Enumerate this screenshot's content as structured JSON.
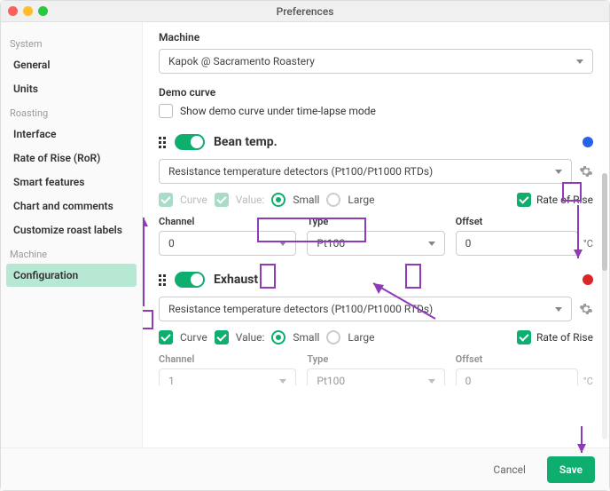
{
  "window": {
    "title": "Preferences"
  },
  "sidebar": {
    "groups": [
      {
        "label": "System",
        "items": [
          "General",
          "Units"
        ]
      },
      {
        "label": "Roasting",
        "items": [
          "Interface",
          "Rate of Rise (RoR)",
          "Smart features",
          "Chart and comments",
          "Customize roast labels"
        ]
      },
      {
        "label": "Machine",
        "items": [
          "Configuration"
        ]
      }
    ],
    "active": "Configuration"
  },
  "main": {
    "machine_label": "Machine",
    "machine_value": "Kapok @ Sacramento Roastery",
    "demo_label": "Demo curve",
    "demo_text": "Show demo curve under time-lapse mode"
  },
  "sensors": [
    {
      "name": "Bean temp.",
      "color": "blue",
      "detector": "Resistance temperature detectors (Pt100/Pt1000 RTDs)",
      "curve_disabled": true,
      "value_disabled": true,
      "curve_label": "Curve",
      "value_label": "Value:",
      "size_small": "Small",
      "size_large": "Large",
      "size_selected": "small",
      "ror_label": "Rate of Rise",
      "channel_label": "Channel",
      "channel_value": "0",
      "type_label": "Type",
      "type_value": "Pt100",
      "offset_label": "Offset",
      "offset_value": "0",
      "offset_unit": "°C"
    },
    {
      "name": "Exhaust",
      "color": "red",
      "detector": "Resistance temperature detectors (Pt100/Pt1000 RTDs)",
      "curve_disabled": false,
      "value_disabled": false,
      "curve_label": "Curve",
      "value_label": "Value:",
      "size_small": "Small",
      "size_large": "Large",
      "size_selected": "small",
      "ror_label": "Rate of Rise",
      "channel_label": "Channel",
      "channel_value": "1",
      "type_label": "Type",
      "type_value": "Pt100",
      "offset_label": "Offset",
      "offset_value": "0",
      "offset_unit": "°C"
    }
  ],
  "footer": {
    "cancel": "Cancel",
    "save": "Save"
  }
}
